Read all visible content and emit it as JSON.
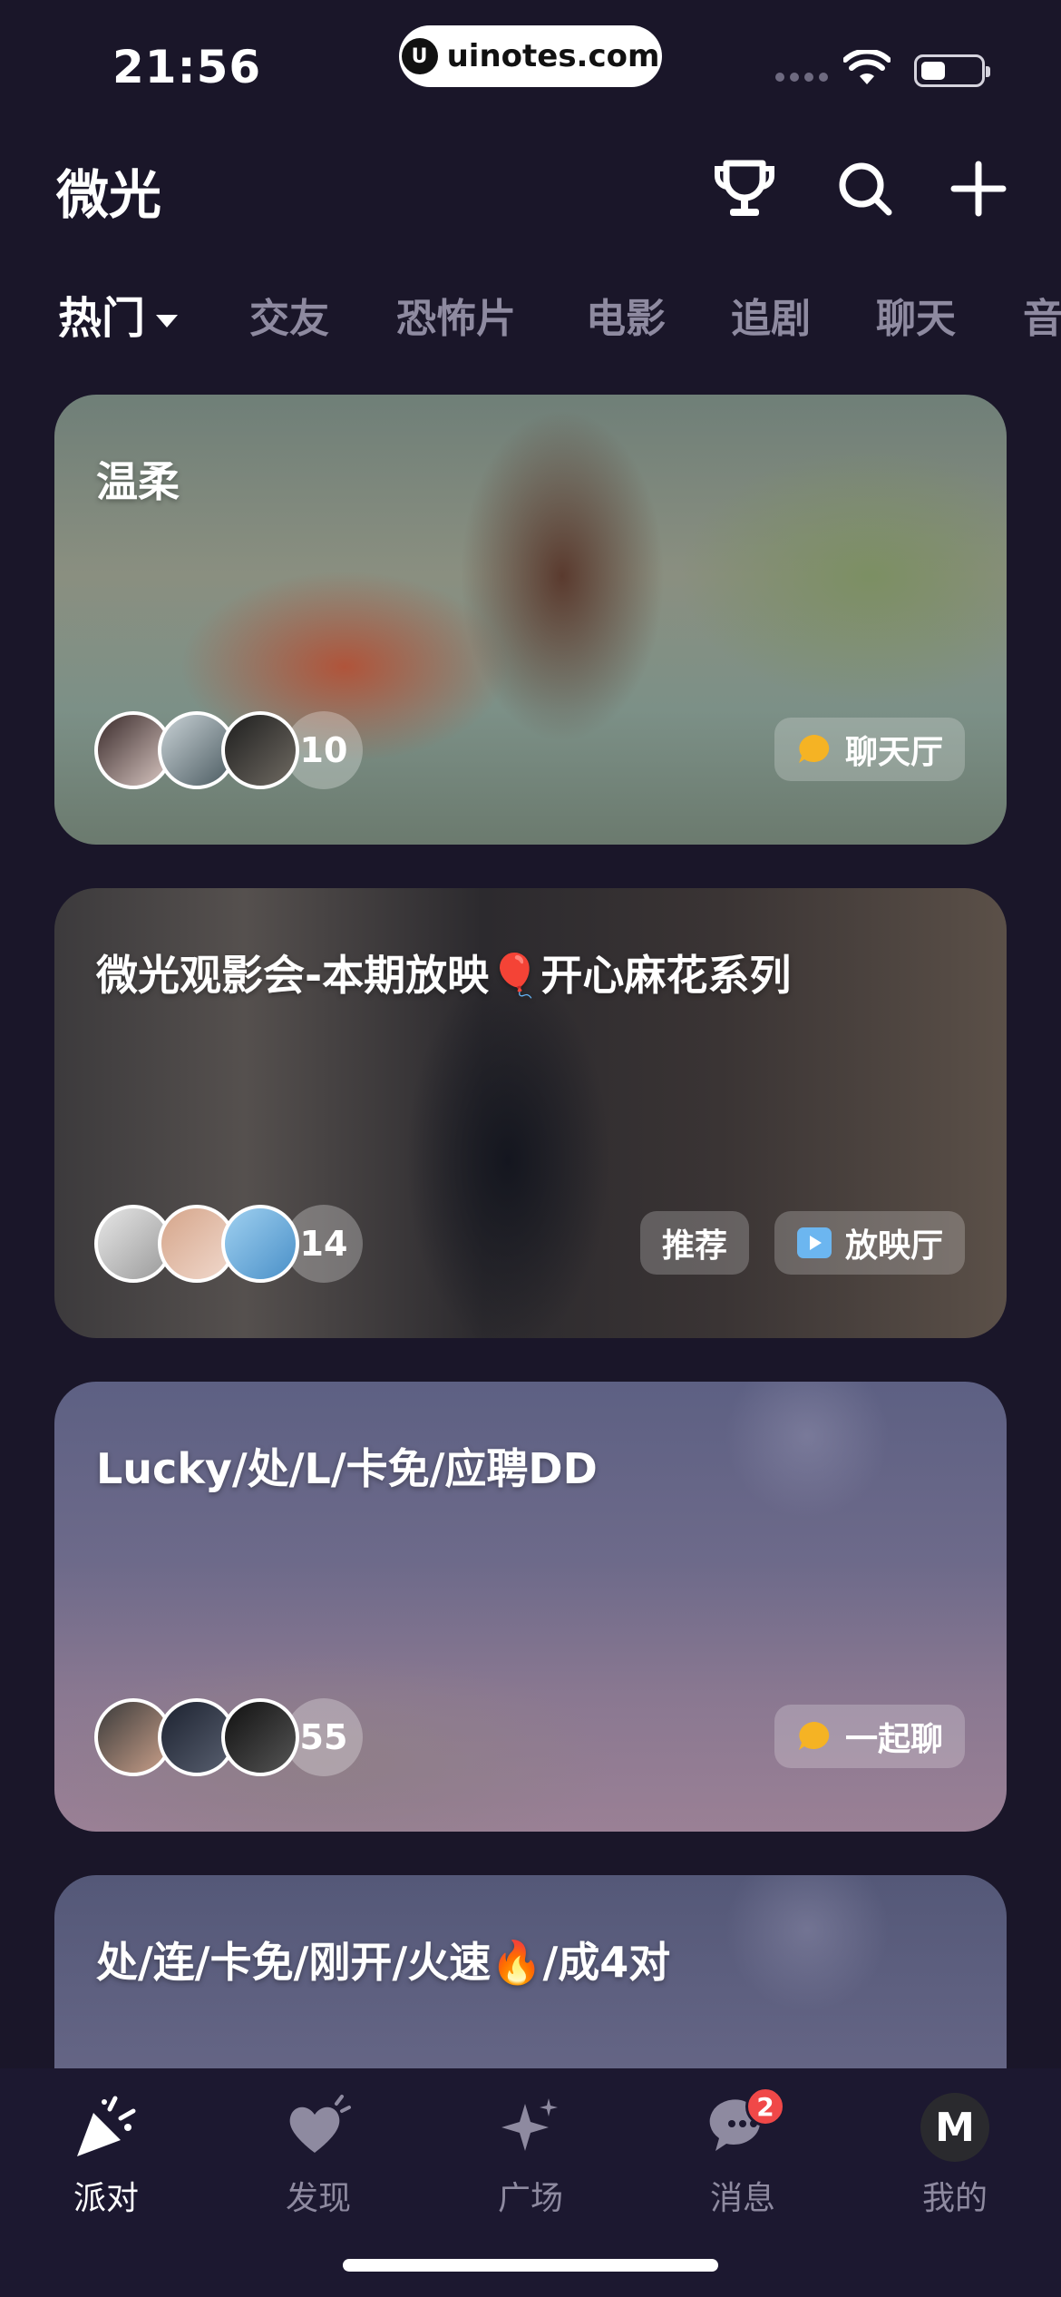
{
  "status_bar": {
    "time": "21:56",
    "url": "uinotes.com",
    "url_logo": "U"
  },
  "header": {
    "title": "微光",
    "icons": [
      "trophy-icon",
      "search-icon",
      "plus-icon"
    ]
  },
  "tabs": [
    {
      "label": "热门",
      "active": true
    },
    {
      "label": "交友"
    },
    {
      "label": "恐怖片"
    },
    {
      "label": "电影"
    },
    {
      "label": "追剧"
    },
    {
      "label": "聊天"
    },
    {
      "label": "音"
    }
  ],
  "cards": [
    {
      "title": "温柔",
      "member_count": "10",
      "tags": [
        {
          "label": "聊天厅",
          "icon": "chat-bubble-icon"
        }
      ]
    },
    {
      "title": "微光观影会-本期放映🎈开心麻花系列",
      "member_count": "14",
      "tags": [
        {
          "label": "推荐"
        },
        {
          "label": "放映厅",
          "icon": "play-icon"
        }
      ]
    },
    {
      "title": "Lucky/处/L/卡免/应聘DD",
      "member_count": "55",
      "tags": [
        {
          "label": "一起聊",
          "icon": "chat-bubble-icon"
        }
      ]
    },
    {
      "title": "处/连/卡免/刚开/火速🔥/成4对"
    }
  ],
  "tab_bar": [
    {
      "label": "派对",
      "icon": "party-popper-icon",
      "active": true
    },
    {
      "label": "发现",
      "icon": "heart-icon"
    },
    {
      "label": "广场",
      "icon": "sparkle-icon"
    },
    {
      "label": "消息",
      "icon": "message-icon",
      "badge": "2"
    },
    {
      "label": "我的",
      "icon": "profile-avatar-icon",
      "avatar_letter": "M"
    }
  ],
  "colors": {
    "background": "#1a1629",
    "accent_chat": "#f5b324",
    "accent_play": "#6cb6f0",
    "badge": "#f04848"
  }
}
